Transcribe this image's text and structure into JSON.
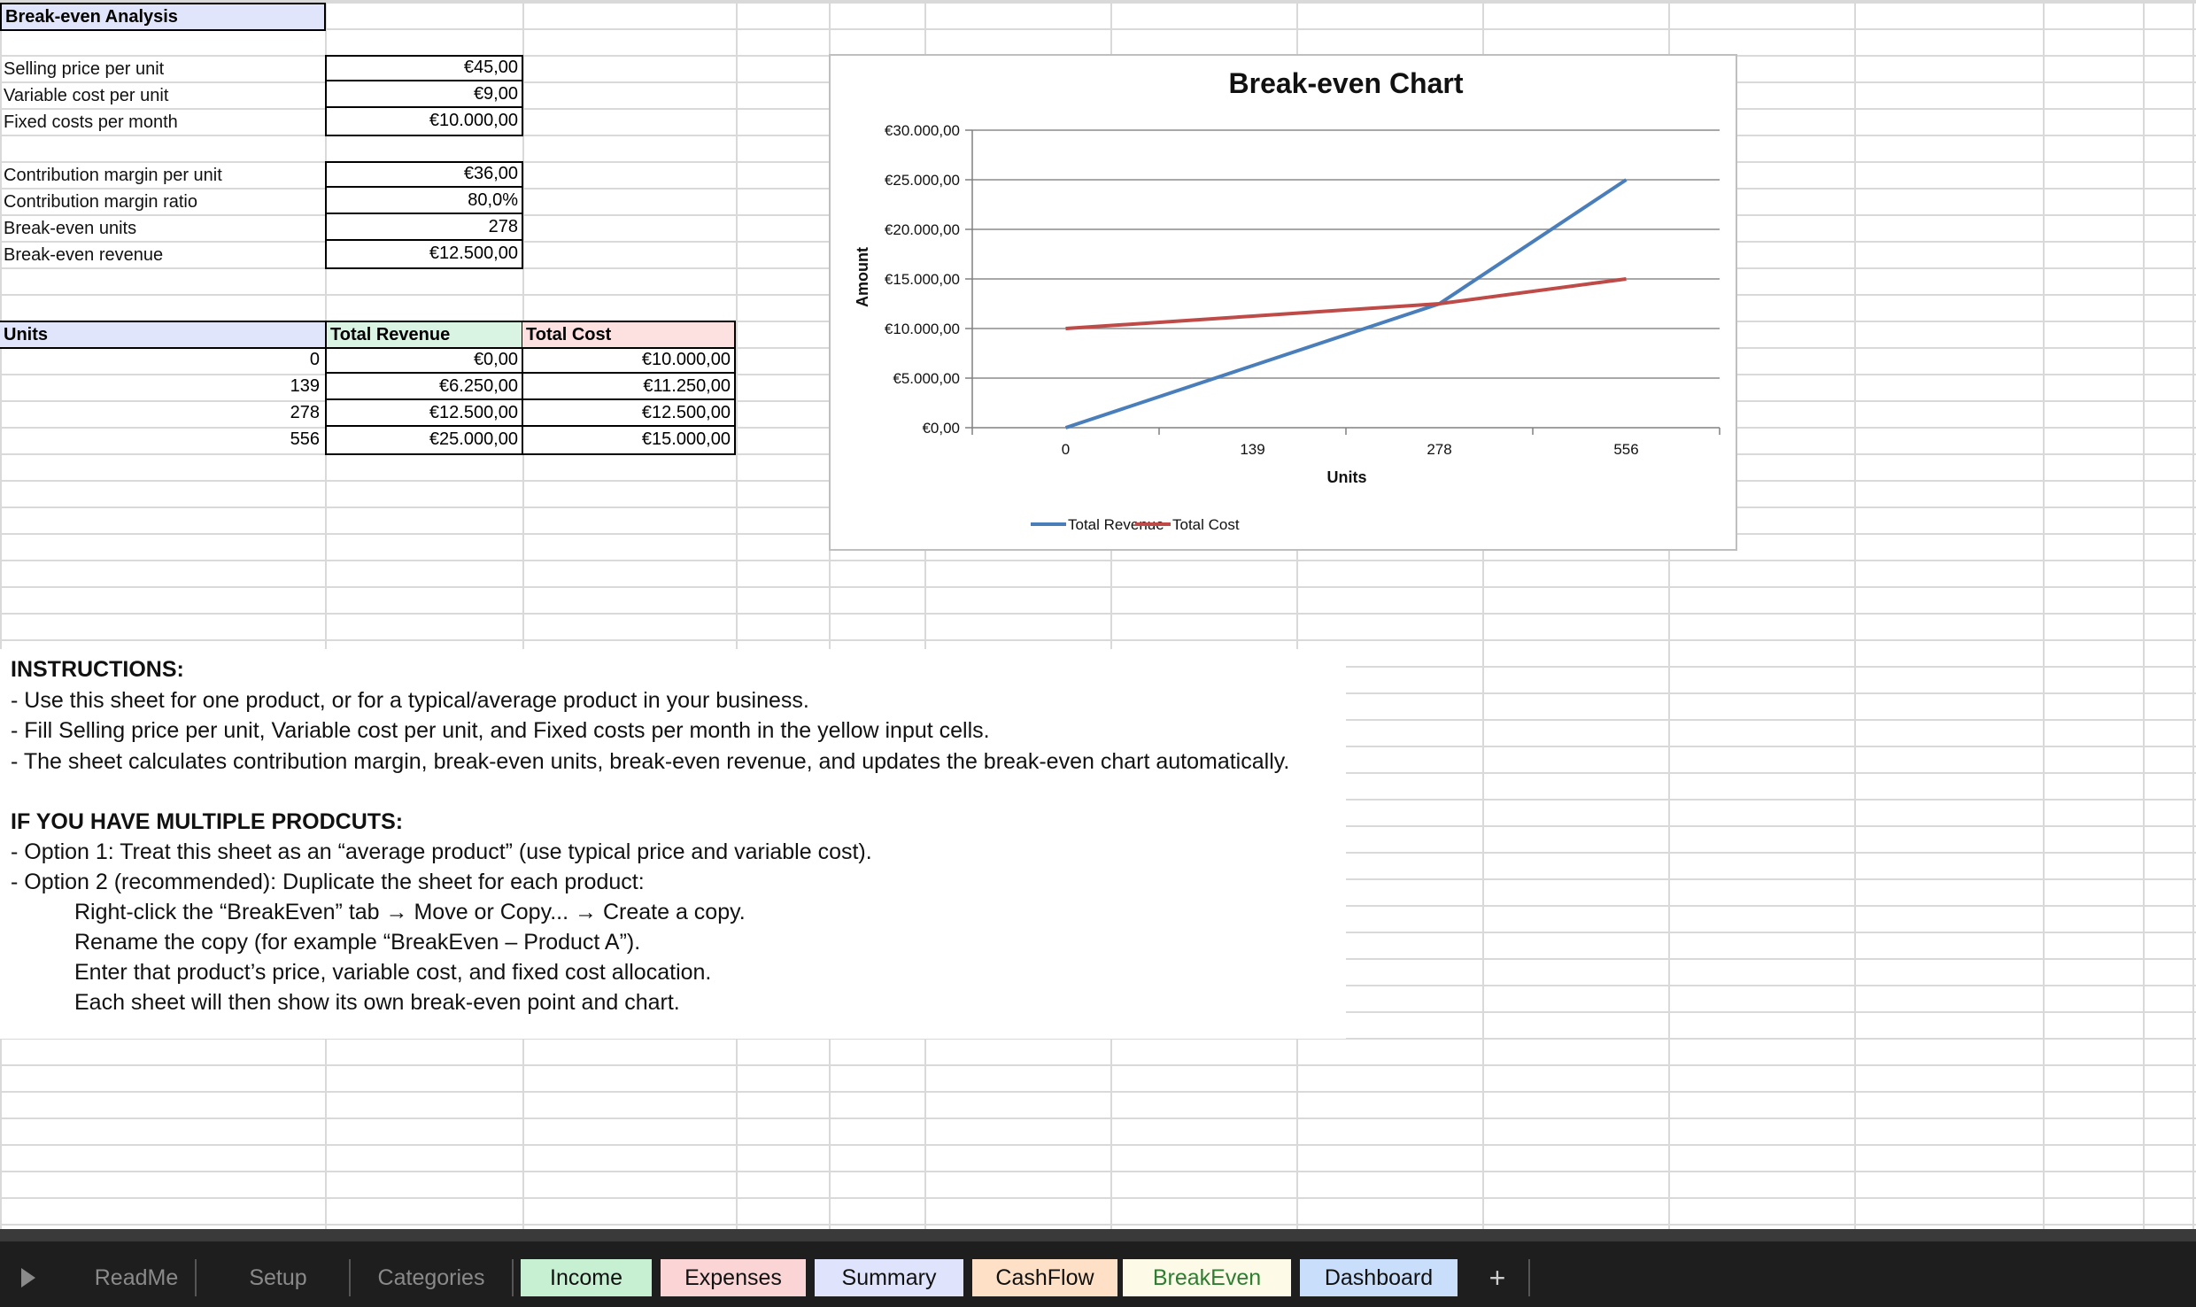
{
  "sheet": {
    "title": "Break-even Analysis",
    "inputs": [
      {
        "label": "Selling price per unit",
        "value": "€45,00"
      },
      {
        "label": "Variable cost per unit",
        "value": "€9,00"
      },
      {
        "label": "Fixed costs per month",
        "value": "€10.000,00"
      }
    ],
    "outputs": [
      {
        "label": "Contribution margin per unit",
        "value": "€36,00"
      },
      {
        "label": "Contribution margin ratio",
        "value": "80,0%"
      },
      {
        "label": "Break-even units",
        "value": "278"
      },
      {
        "label": "Break-even revenue",
        "value": "€12.500,00"
      }
    ],
    "table": {
      "headers": [
        "Units",
        "Total Revenue",
        "Total Cost"
      ],
      "rows": [
        [
          "0",
          "€0,00",
          "€10.000,00"
        ],
        [
          "139",
          "€6.250,00",
          "€11.250,00"
        ],
        [
          "278",
          "€12.500,00",
          "€12.500,00"
        ],
        [
          "556",
          "€25.000,00",
          "€15.000,00"
        ]
      ]
    }
  },
  "chart_data": {
    "type": "line",
    "title": "Break-even Chart",
    "xlabel": "Units",
    "ylabel": "Amount",
    "categories": [
      "0",
      "139",
      "278",
      "556"
    ],
    "x": [
      0,
      139,
      278,
      556
    ],
    "series": [
      {
        "name": "Total Revenue",
        "values": [
          0,
          6250,
          12500,
          25000
        ],
        "color": "#4a7ebb"
      },
      {
        "name": "Total Cost",
        "values": [
          10000,
          11250,
          12500,
          15000
        ],
        "color": "#be4b48"
      }
    ],
    "ylim": [
      0,
      30000
    ],
    "yticks": [
      "€0,00",
      "€5.000,00",
      "€10.000,00",
      "€15.000,00",
      "€20.000,00",
      "€25.000,00",
      "€30.000,00"
    ],
    "grid": true,
    "legend": "bottom"
  },
  "instructions": {
    "heading": "INSTRUCTIONS:",
    "lines": [
      "- Use this sheet for one product, or for a typical/average product in your business.",
      "- Fill Selling price per unit, Variable cost per unit, and Fixed costs per month in the yellow input cells.",
      "- The sheet calculates contribution margin, break-even units, break-even revenue, and updates the break-even chart automatically."
    ],
    "heading2": "IF YOU HAVE MULTIPLE PRODCUTS:",
    "lines2": [
      "- Option 1: Treat this sheet as an “average product” (use typical price and variable cost).",
      "- Option 2 (recommended): Duplicate the sheet for each product:"
    ],
    "steps": [
      "Right-click the “BreakEven” tab → Move or Copy... → Create a copy.",
      "Rename the copy (for example “BreakEven – Product A”).",
      "Enter that product’s price, variable cost, and fixed cost allocation.",
      "Each sheet will then show its own break-even point and chart."
    ]
  },
  "tabs": [
    {
      "label": "ReadMe",
      "bg": "",
      "color": "#8a8a8a"
    },
    {
      "label": "Setup",
      "bg": "",
      "color": "#8a8a8a"
    },
    {
      "label": "Categories",
      "bg": "",
      "color": "#8a8a8a"
    },
    {
      "label": "Income",
      "bg": "#c7f0d2",
      "color": "#111"
    },
    {
      "label": "Expenses",
      "bg": "#fbd5d5",
      "color": "#111"
    },
    {
      "label": "Summary",
      "bg": "#dfe3fb",
      "color": "#111"
    },
    {
      "label": "CashFlow",
      "bg": "#fde0c6",
      "color": "#111"
    },
    {
      "label": "BreakEven",
      "bg": "#fdfbe8",
      "color": "#2e7d32"
    },
    {
      "label": "Dashboard",
      "bg": "#c9defb",
      "color": "#111"
    }
  ],
  "add_tab": "+",
  "colors": {
    "title_bg": "#e1e5fb",
    "rev_header_bg": "#d9f4e3",
    "cost_header_bg": "#fde0e0"
  }
}
